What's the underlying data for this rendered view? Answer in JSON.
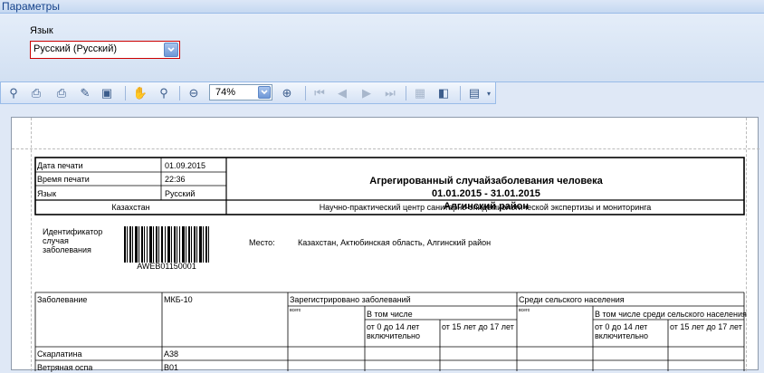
{
  "params": {
    "header": "Параметры",
    "lang_label": "Язык",
    "lang_value": "Русский (Русский)"
  },
  "toolbar": {
    "zoom": "74%"
  },
  "report": {
    "print_date_label": "Дата печати",
    "print_date": "01.09.2015",
    "print_time_label": "Время печати",
    "print_time": "22:36",
    "lang_label": "Язык",
    "lang_value": "Русский",
    "country": "Казахстан",
    "org": "Научно-практический центр санитарно-эпидемиологической экспертизы и мониторинга",
    "title1": "Агрегированный случайзаболевания человека",
    "title2": "01.01.2015 - 31.01.2015",
    "title3": "Алгинский район",
    "case_id_label": "Идентификатор случая заболевания",
    "barcode_text": "AWEB01150001",
    "place_label": "Место:",
    "place_value": "Казахстан, Актюбинская область, Алгинский район",
    "table": {
      "col_disease": "Заболевание",
      "col_mkb": "МКБ-10",
      "col_registered": "Зарегистрировано заболеваний",
      "col_rural": "Среди сельского населения",
      "col_total": "всего",
      "col_incl": "В том числе",
      "col_incl_rural": "В том числе среди сельского населения",
      "col_0_14": "от 0 до 14 лет включительно",
      "col_15_17": "от 15 лет до 17 лет",
      "rows": [
        {
          "name": "Скарлатина",
          "code": "A38"
        },
        {
          "name": "Ветряная оспа",
          "code": "B01"
        }
      ]
    }
  }
}
